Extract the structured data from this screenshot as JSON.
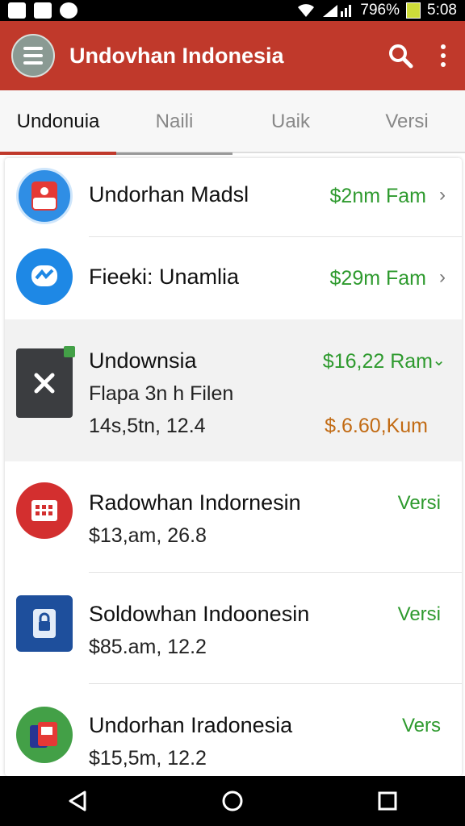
{
  "status_bar": {
    "battery_text": "796%",
    "time": "5:08",
    "icons": [
      "notification-icon",
      "upload-icon",
      "record-icon",
      "wifi-icon",
      "signal-icon",
      "battery-icon"
    ]
  },
  "app_bar": {
    "title": "Undovhan Indonesia",
    "icons": [
      "menu-icon",
      "search-icon",
      "more-vert-icon"
    ],
    "color": "#c0392b"
  },
  "tabs": [
    {
      "label": "Undonuia",
      "active": true
    },
    {
      "label": "Naili",
      "active": false
    },
    {
      "label": "Uaik",
      "active": false
    },
    {
      "label": "Versi",
      "active": false
    }
  ],
  "list": [
    {
      "title": "Undorhan Madsl",
      "price": "$2nm Fam",
      "icon": "app-icon-red-blue"
    },
    {
      "title": "Fieeki: Unamlia",
      "price": "$29m Fam",
      "icon": "messenger-icon"
    },
    {
      "title": "Undownsia",
      "price": "$16,22 Ram",
      "line2": "Flapa 3n h Filen",
      "line3": "14s,5tn, 12.4",
      "price2": "$.6.60,Kum",
      "icon": "close-box-icon"
    },
    {
      "title": "Radowhan Indornesin",
      "sub": "$13,am, 26.8",
      "right": "Versi",
      "icon": "calendar-grid-icon"
    },
    {
      "title": "Soldowhan Indoonesin",
      "sub": "$85.am, 12.2",
      "right": "Versi",
      "icon": "lock-file-icon"
    },
    {
      "title": "Undorhan Iradonesia",
      "sub": "$15,5m, 12.2",
      "right": "Vers",
      "icon": "cards-icon"
    }
  ],
  "nav_bar": {
    "icons": [
      "back-icon",
      "home-icon",
      "recents-icon"
    ]
  },
  "colors": {
    "accent": "#c0392b",
    "price_green": "#2e9a2e",
    "price_orange": "#c26b14"
  }
}
